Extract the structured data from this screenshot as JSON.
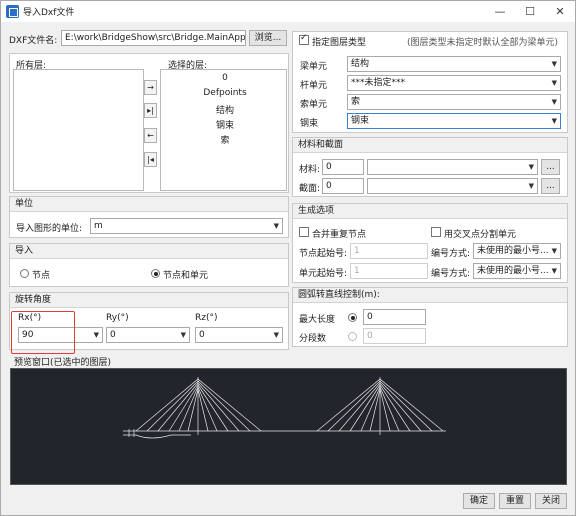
{
  "window": {
    "title": "导入Dxf文件"
  },
  "dxf": {
    "label": "DXF文件名:",
    "path": "E:\\work\\BridgeShow\\src\\Bridge.MainApp\\",
    "browse": "浏览..."
  },
  "layers": {
    "all_title": "所有层:",
    "selected_title": "选择的层:",
    "selected_items": [
      "0",
      "Defpoints",
      "结构",
      "钢束",
      "索"
    ],
    "move_right": "→",
    "move_all_right": "▸|",
    "move_left": "←",
    "move_all_left": "|◂"
  },
  "unit": {
    "title": "单位",
    "label": "导入图形的单位:",
    "value": "m"
  },
  "import": {
    "title": "导入",
    "opt_nodes": "节点",
    "opt_nodes_elems": "节点和单元"
  },
  "rotation": {
    "title": "旋转角度",
    "rx_label": "Rx(°)",
    "rx_value": "90",
    "ry_label": "Ry(°)",
    "ry_value": "0",
    "rz_label": "Rz(°)",
    "rz_value": "0"
  },
  "layer_type": {
    "title": "指定图层类型",
    "hint": "(图层类型未指定时默认全部为梁单元)",
    "beam_label": "梁单元",
    "beam_value": "结构",
    "truss_label": "杆单元",
    "truss_value": "***未指定***",
    "cable_label": "索单元",
    "cable_value": "索",
    "tendon_label": "钢束",
    "tendon_value": "钢束"
  },
  "material": {
    "title": "材料和截面",
    "mat_label": "材料:",
    "mat_value": "0",
    "sec_label": "截面:",
    "sec_value": "0",
    "more": "..."
  },
  "gen": {
    "title": "生成选项",
    "merge": "合并重复节点",
    "split": "用交叉点分割单元",
    "node_start_label": "节点起始号:",
    "node_start": "1",
    "elem_start_label": "单元起始号:",
    "elem_start": "1",
    "numbering_label": "编号方式:",
    "numbering_value": "未使用的最小号..."
  },
  "arc": {
    "title": "圆弧转直线控制(m):",
    "maxlen_label": "最大长度",
    "maxlen_value": "0",
    "segments_label": "分段数",
    "segments_value": "0"
  },
  "preview": {
    "title": "预览窗口(已选中的图层)"
  },
  "footer": {
    "ok": "确定",
    "reset": "重置",
    "close": "关闭"
  },
  "colors": {
    "accent": "#3c7fd6",
    "highlight": "#e23b3b",
    "preview_bg": "#22252b"
  }
}
